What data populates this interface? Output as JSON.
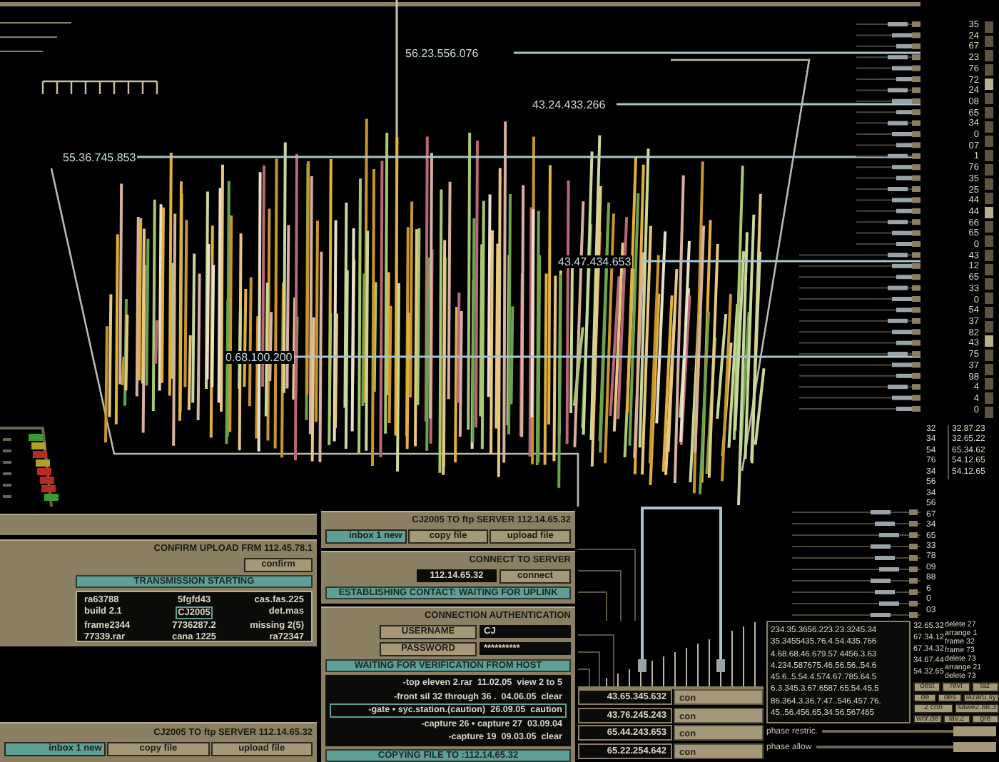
{
  "visualization": {
    "ip_labels": [
      {
        "text": "56.23.556.076"
      },
      {
        "text": "43.24.433.266"
      },
      {
        "text": "55.36.745.853"
      },
      {
        "text": "43.47.434.653"
      },
      {
        "text": "0.68.100.200"
      }
    ],
    "level_meter": {
      "segments": [
        {
          "color": "#3c9a2c"
        },
        {
          "color": "#b0a02a"
        },
        {
          "color": "#b82a22"
        },
        {
          "color": "#b0a02a"
        },
        {
          "color": "#b82a22"
        },
        {
          "color": "#b82a22"
        },
        {
          "color": "#b82a22"
        },
        {
          "color": "#3c9a2c"
        }
      ]
    }
  },
  "scale_readings": {
    "column_1": [
      "35",
      "24",
      "67",
      "23",
      "76",
      "72",
      "24",
      "08",
      "65",
      "34",
      "0",
      "07",
      "1",
      "76",
      "35",
      "25",
      "44",
      "44",
      "66",
      "65",
      "0",
      "43",
      "12",
      "65",
      "33",
      "0",
      "54",
      "37",
      "82",
      "43",
      "75",
      "37",
      "98",
      "4",
      "4",
      "0"
    ],
    "column_2": [
      "32",
      "34",
      "54",
      "76",
      "34",
      "56",
      "34",
      "56",
      "67",
      "34",
      "65",
      "33",
      "78",
      "09",
      "88",
      "6",
      "0",
      "03"
    ],
    "addresses": [
      "32.87.23",
      "32.65.22",
      "65.34.62",
      "54.12.65",
      "54.12.65"
    ]
  },
  "upload_panel": {
    "header": "CONFIRM UPLOAD FRM 112.45.78.1",
    "confirm_button": "confirm",
    "status": "TRANSMISSION STARTING",
    "files": [
      {
        "text": "ra63788",
        "selected": false
      },
      {
        "text": "5fgfd43",
        "selected": false
      },
      {
        "text": "cas.fas.225",
        "selected": false
      },
      {
        "text": "build 2.1",
        "selected": false
      },
      {
        "text": "CJ2005",
        "selected": true
      },
      {
        "text": "det.mas",
        "selected": false
      },
      {
        "text": "frame2344",
        "selected": false
      },
      {
        "text": "7736287.2",
        "selected": false
      },
      {
        "text": "missing 2(5)",
        "selected": false
      },
      {
        "text": "77339.rar",
        "selected": false
      },
      {
        "text": "cana 1225",
        "selected": false
      },
      {
        "text": "ra72347",
        "selected": false
      }
    ],
    "footer": {
      "header": "CJ2005 TO ftp SERVER 112.14.65.32",
      "buttons": [
        {
          "label": "inbox 1 new",
          "selected": true
        },
        {
          "label": "copy file",
          "selected": false
        },
        {
          "label": "upload file",
          "selected": false
        }
      ]
    }
  },
  "server_panel": {
    "header": "CJ2005 TO ftp SERVER 112.14.65.32",
    "buttons": [
      {
        "label": "inbox 1 new",
        "selected": true
      },
      {
        "label": "copy file",
        "selected": false
      },
      {
        "label": "upload file",
        "selected": false
      }
    ],
    "connect": {
      "title": "CONNECT TO SERVER",
      "address": "112.14.65.32",
      "button": "connect",
      "status": "ESTABLISHING CONTACT: WAITING FOR UPLINK"
    },
    "auth": {
      "title": "CONNECTION AUTHENTICATION",
      "fields": [
        {
          "label": "USERNAME",
          "value": "CJ"
        },
        {
          "label": "PASSWORD",
          "value": "**********"
        }
      ],
      "status": "WAITING FOR VERIFICATION FROM HOST"
    },
    "log": [
      {
        "text": "-top eleven 2.rar  11.02.05  view 2 to 5",
        "selected": false
      },
      {
        "text": "-front sil 32 through 36 .  04.06.05  clear",
        "selected": false
      },
      {
        "text": "-gate • syc.station.(caution)  26.09.05  caution",
        "selected": true
      },
      {
        "text": "-capture 26 • capture 27  03.09.04",
        "selected": false
      },
      {
        "text": "-capture 19  09.03.05  clear",
        "selected": false
      }
    ],
    "footer_status": "COPYING FILE TO :112.14.65.32"
  },
  "host_panel": {
    "hosts": [
      {
        "address": "43.65.345.632",
        "action": "con"
      },
      {
        "address": "43.76.245.243",
        "action": "con"
      },
      {
        "address": "65.44.243.653",
        "action": "con"
      },
      {
        "address": "65.22.254.642",
        "action": "con"
      }
    ],
    "routes": [
      {
        "address": "234.35.3656.223.23.3245.34",
        "code": "32.65.32"
      },
      {
        "address": "35.3455435.76.4.54.435.766",
        "code": "67.34.12"
      },
      {
        "address": "4.68.68.46.679.57.4456.3.63",
        "code": "67.34.32"
      },
      {
        "address": "4.234.587675.46.56.56..54.6",
        "code": "34.67.44"
      },
      {
        "address": "45.6..5.54.4.574.67.785.64.5",
        "code": "54.32.65"
      },
      {
        "address": "6.3.345.3.67.6587.65.54.45.5"
      },
      {
        "address": "86.364.3.36.7.47..546.457.76."
      },
      {
        "address": "45..56.456.65.34.56.567465"
      }
    ],
    "actions": [
      "delete 27",
      "arrange 1",
      "frame 32",
      "frame 73",
      "delete 73",
      "arrange 21",
      "delete 73"
    ],
    "commands": [
      [
        "dest",
        "revl",
        "laz"
      ],
      [
        "de",
        "des",
        "lazaru.sy"
      ],
      [
        "2 con",
        "sawe2.88.3"
      ],
      [
        "wor.de",
        "lav.2",
        "gre"
      ]
    ],
    "phases": [
      {
        "label": "phase restric.",
        "level": 1
      },
      {
        "label": "phase allow",
        "level": 1
      }
    ]
  }
}
